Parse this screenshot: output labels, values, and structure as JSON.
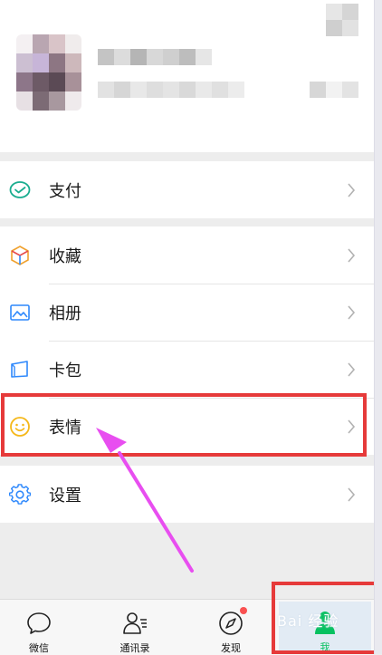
{
  "menu": {
    "pay": "支付",
    "favorites": "收藏",
    "album": "相册",
    "cards": "卡包",
    "stickers": "表情",
    "settings": "设置"
  },
  "tabs": {
    "chats": "微信",
    "contacts": "通讯录",
    "discover": "发现",
    "me": "我"
  },
  "watermark": "Bai 经验",
  "colors": {
    "highlight": "#e63a3a",
    "arrow": "#e84ef0",
    "active_tab": "#07c160",
    "badge": "#fa5151"
  }
}
